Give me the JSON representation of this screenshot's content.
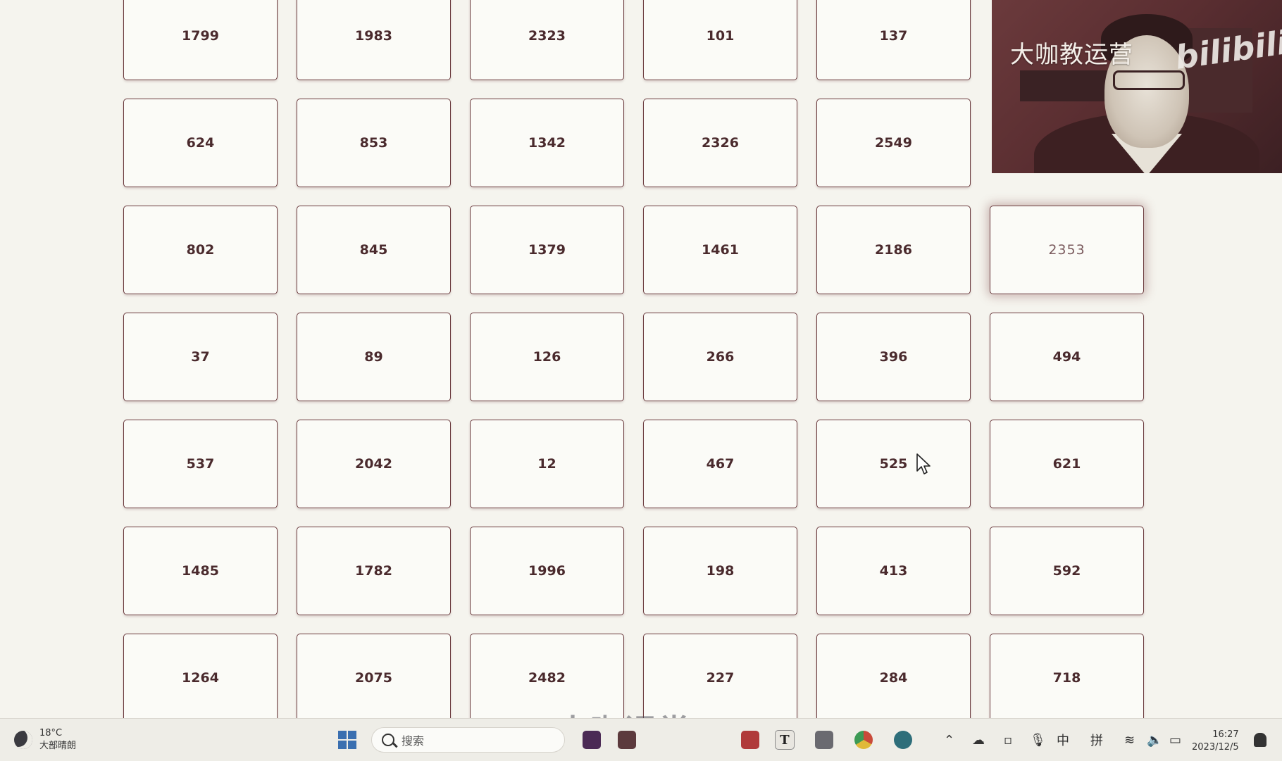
{
  "grid": {
    "cards": [
      "1799",
      "1983",
      "2323",
      "101",
      "137",
      "",
      "624",
      "853",
      "1342",
      "2326",
      "2549",
      "",
      "802",
      "845",
      "1379",
      "1461",
      "2186",
      "2353",
      "37",
      "89",
      "126",
      "266",
      "396",
      "494",
      "537",
      "2042",
      "12",
      "467",
      "525",
      "621",
      "1485",
      "1782",
      "1996",
      "198",
      "413",
      "592",
      "1264",
      "2075",
      "2482",
      "227",
      "284",
      "718"
    ],
    "highlighted": "2353"
  },
  "webcam": {
    "title": "大咖教运营",
    "logo": "bilibili"
  },
  "taskbar": {
    "weather_temp": "18°C",
    "weather_desc": "大部晴朗",
    "search_placeholder": "搜索",
    "watermark": "大咖课堂",
    "ime_lang": "中",
    "ime_mode": "拼",
    "time": "16:27",
    "date": "2023/12/5",
    "accent": "#3a6fb0"
  }
}
